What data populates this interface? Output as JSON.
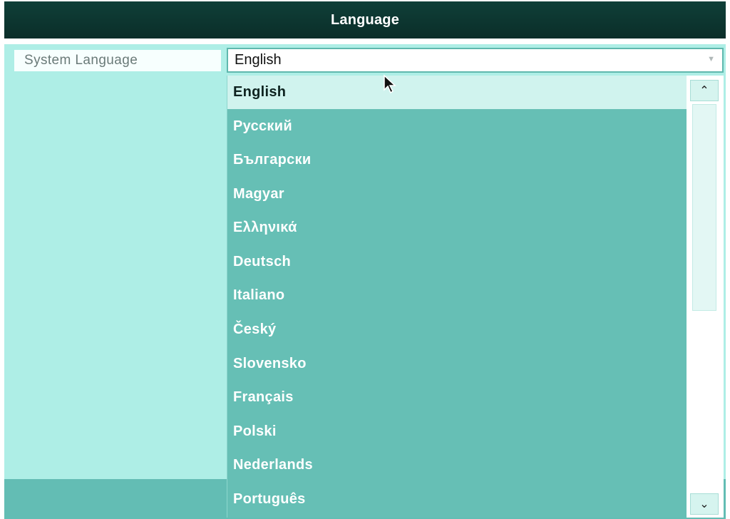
{
  "window": {
    "title": "Language"
  },
  "settings": {
    "system_language_label": "System Language",
    "system_language_value": "English"
  },
  "dropdown": {
    "options": [
      "English",
      "Русский",
      "Български",
      "Magyar",
      "Ελληνικά",
      "Deutsch",
      "Italiano",
      "Český",
      "Slovensko",
      "Français",
      "Polski",
      "Nederlands",
      "Português"
    ],
    "selected_index": 0
  },
  "icons": {
    "scroll_up": "chevron-up-icon",
    "scroll_down": "chevron-down-icon",
    "select_caret": "chevron-down-icon",
    "cursor": "mouse-pointer-icon"
  },
  "colors": {
    "title_bar": "#0b2e29",
    "content_bg": "#aeeee6",
    "dropdown_bg": "#66bfb5",
    "selected_option_bg": "#d0f3ee"
  }
}
